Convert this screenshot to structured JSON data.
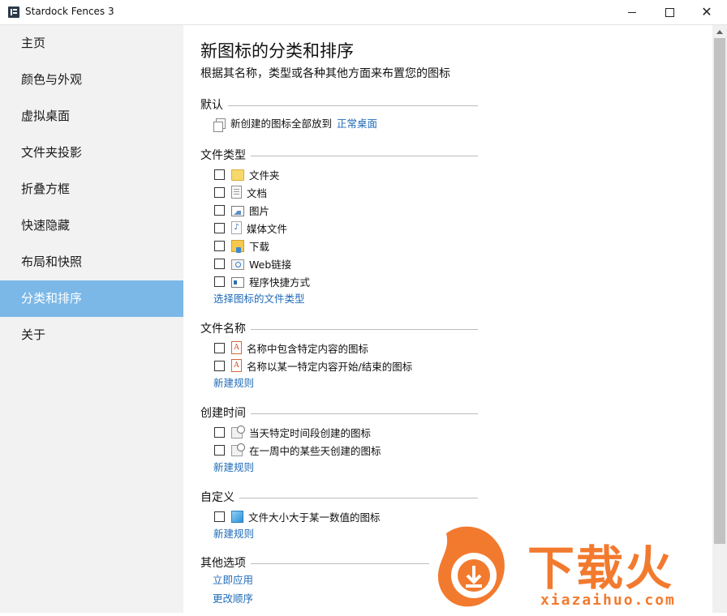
{
  "window": {
    "title": "Stardock Fences 3",
    "close_glyph": "✕"
  },
  "sidebar": {
    "items": [
      {
        "label": "主页"
      },
      {
        "label": "颜色与外观"
      },
      {
        "label": "虚拟桌面"
      },
      {
        "label": "文件夹投影"
      },
      {
        "label": "折叠方框"
      },
      {
        "label": "快速隐藏"
      },
      {
        "label": "布局和快照"
      },
      {
        "label": "分类和排序",
        "active": true
      },
      {
        "label": "关于"
      }
    ]
  },
  "main": {
    "title": "新图标的分类和排序",
    "subtitle": "根据其名称，类型或各种其他方面来布置您的图标",
    "default": {
      "heading": "默认",
      "text": "新创建的图标全部放到",
      "link": "正常桌面"
    },
    "file_types": {
      "heading": "文件类型",
      "items": [
        {
          "label": "文件夹",
          "icon": "folder-icon",
          "checked": false
        },
        {
          "label": "文档",
          "icon": "document-icon",
          "checked": false
        },
        {
          "label": "图片",
          "icon": "picture-icon",
          "checked": false
        },
        {
          "label": "媒体文件",
          "icon": "media-icon",
          "checked": false
        },
        {
          "label": "下载",
          "icon": "download-icon",
          "checked": false
        },
        {
          "label": "Web链接",
          "icon": "web-link-icon",
          "checked": false
        },
        {
          "label": "程序快捷方式",
          "icon": "shortcut-icon",
          "checked": false
        }
      ],
      "link": "选择图标的文件类型"
    },
    "file_name": {
      "heading": "文件名称",
      "items": [
        {
          "label": "名称中包含特定内容的图标",
          "icon": "name-rule-icon",
          "checked": false
        },
        {
          "label": "名称以某一特定内容开始/结束的图标",
          "icon": "name-rule-icon",
          "checked": false
        }
      ],
      "link": "新建规则"
    },
    "created_time": {
      "heading": "创建时间",
      "items": [
        {
          "label": "当天特定时间段创建的图标",
          "icon": "clock-icon",
          "checked": false
        },
        {
          "label": "在一周中的某些天创建的图标",
          "icon": "clock-icon",
          "checked": false
        }
      ],
      "link": "新建规则"
    },
    "custom": {
      "heading": "自定义",
      "items": [
        {
          "label": "文件大小大于某一数值的图标",
          "icon": "size-icon",
          "checked": false
        }
      ],
      "link": "新建规则"
    },
    "other": {
      "heading": "其他选项",
      "links": [
        "立即应用",
        "更改顺序"
      ]
    }
  },
  "watermark": {
    "text": "下载火",
    "url": "xiazaihuo.com"
  },
  "colors": {
    "active_nav": "#7bb8e8",
    "link": "#1f6bb8",
    "watermark": "#f27a2e"
  }
}
